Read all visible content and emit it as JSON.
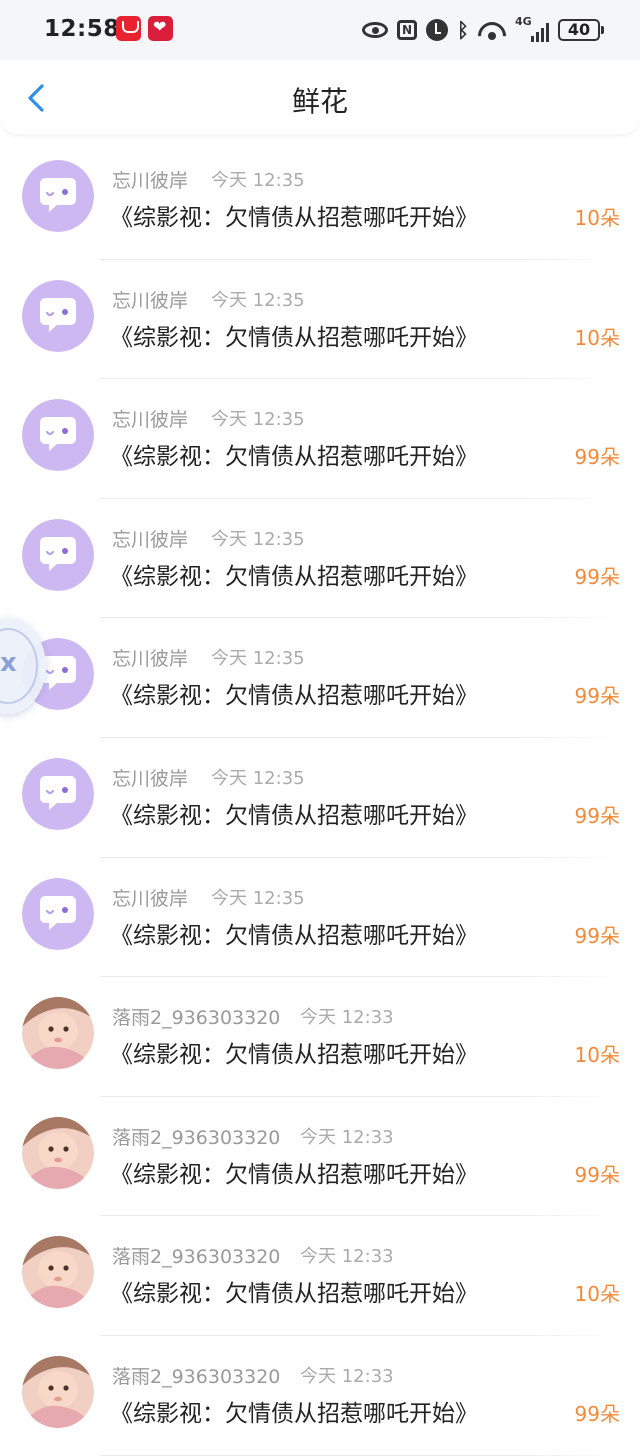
{
  "status_bar": {
    "time": "12:58",
    "battery": "40",
    "network": "4G",
    "icons": [
      "huawei-app-icon",
      "favorites-app-icon",
      "eye-icon",
      "nfc-icon",
      "alarm-icon",
      "bluetooth-icon",
      "wifi-icon",
      "signal-icon",
      "battery-icon"
    ]
  },
  "nav": {
    "title": "鲜花",
    "back_icon": "chevron-left-icon"
  },
  "colors": {
    "accent": "#2f8fe8",
    "count": "#f28a3a",
    "avatar_default": "#cdb8f2"
  },
  "items": [
    {
      "avatar": "default-bubble",
      "user": "忘川彼岸",
      "time": "今天 12:35",
      "title": "《综影视：欠情债从招惹哪吒开始》",
      "count": "10朵"
    },
    {
      "avatar": "default-bubble",
      "user": "忘川彼岸",
      "time": "今天 12:35",
      "title": "《综影视：欠情债从招惹哪吒开始》",
      "count": "10朵"
    },
    {
      "avatar": "default-bubble",
      "user": "忘川彼岸",
      "time": "今天 12:35",
      "title": "《综影视：欠情债从招惹哪吒开始》",
      "count": "99朵"
    },
    {
      "avatar": "default-bubble",
      "user": "忘川彼岸",
      "time": "今天 12:35",
      "title": "《综影视：欠情债从招惹哪吒开始》",
      "count": "99朵"
    },
    {
      "avatar": "default-bubble",
      "user": "忘川彼岸",
      "time": "今天 12:35",
      "title": "《综影视：欠情债从招惹哪吒开始》",
      "count": "99朵"
    },
    {
      "avatar": "default-bubble",
      "user": "忘川彼岸",
      "time": "今天 12:35",
      "title": "《综影视：欠情债从招惹哪吒开始》",
      "count": "99朵"
    },
    {
      "avatar": "default-bubble",
      "user": "忘川彼岸",
      "time": "今天 12:35",
      "title": "《综影视：欠情债从招惹哪吒开始》",
      "count": "99朵"
    },
    {
      "avatar": "baby-photo",
      "user": "落雨2_936303320",
      "time": "今天 12:33",
      "title": "《综影视：欠情债从招惹哪吒开始》",
      "count": "10朵"
    },
    {
      "avatar": "baby-photo",
      "user": "落雨2_936303320",
      "time": "今天 12:33",
      "title": "《综影视：欠情债从招惹哪吒开始》",
      "count": "99朵"
    },
    {
      "avatar": "baby-photo",
      "user": "落雨2_936303320",
      "time": "今天 12:33",
      "title": "《综影视：欠情债从招惹哪吒开始》",
      "count": "10朵"
    },
    {
      "avatar": "baby-photo",
      "user": "落雨2_936303320",
      "time": "今天 12:33",
      "title": "《综影视：欠情债从招惹哪吒开始》",
      "count": "99朵"
    }
  ]
}
